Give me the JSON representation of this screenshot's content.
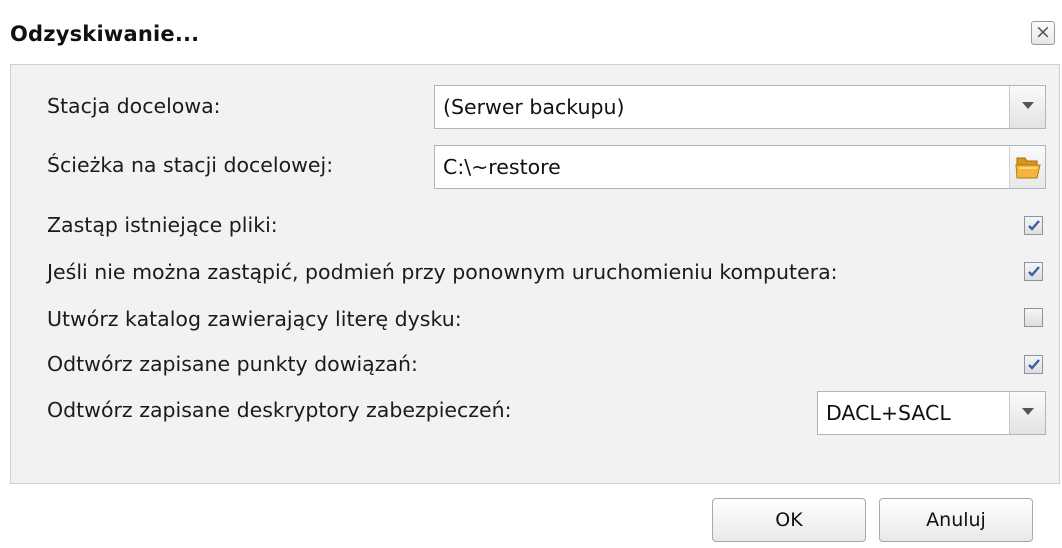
{
  "dialog": {
    "title": "Odzyskiwanie...",
    "close_icon": "close-icon"
  },
  "form": {
    "destination": {
      "label": "Stacja docelowa:",
      "value": "(Serwer backupu)"
    },
    "path": {
      "label": "Ścieżka na stacji docelowej:",
      "value": "C:\\~restore",
      "browse_icon": "folder-open-icon"
    },
    "overwrite": {
      "label": "Zastąp istniejące pliki:",
      "checked": true
    },
    "replace_on_reboot": {
      "label": "Jeśli nie można zastąpić, podmień przy ponownym uruchomieniu komputera:",
      "checked": true
    },
    "create_drive_folder": {
      "label": "Utwórz katalog zawierający literę dysku:",
      "checked": false
    },
    "restore_junctions": {
      "label": "Odtwórz zapisane punkty dowiązań:",
      "checked": true
    },
    "security_descriptors": {
      "label": "Odtwórz zapisane deskryptory zabezpieczeń:",
      "value": "DACL+SACL"
    }
  },
  "buttons": {
    "ok": "OK",
    "cancel": "Anuluj"
  },
  "colors": {
    "panel_bg": "#f2f2f2",
    "checkmark": "#3b5ea8"
  }
}
